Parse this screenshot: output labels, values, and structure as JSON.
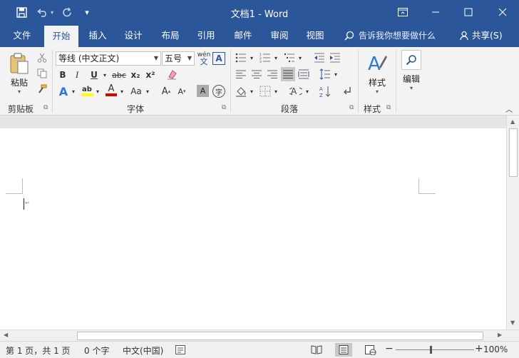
{
  "titlebar": {
    "title": "文档1  -  Word",
    "icons": [
      "save-icon",
      "undo-icon",
      "redo-icon",
      "customize-qat-icon",
      "ribbon-display-icon",
      "minimize-icon",
      "maximize-icon",
      "close-icon"
    ]
  },
  "tabs": [
    "文件",
    "开始",
    "插入",
    "设计",
    "布局",
    "引用",
    "邮件",
    "审阅",
    "视图"
  ],
  "active_tab": "开始",
  "tellme": "告诉我你想要做什么",
  "share": "共享(S)",
  "ribbon": {
    "clipboard": {
      "paste": "粘贴",
      "label": "剪贴板"
    },
    "font": {
      "font_name": "等线 (中文正文)",
      "font_size": "五号",
      "phonetic": "wén",
      "phonetic_char": "文",
      "bold": "B",
      "italic": "I",
      "underline": "U",
      "strike": "abc",
      "subscript": "x₂",
      "superscript": "x²",
      "text_effects": "A",
      "highlight": "ab",
      "font_color": "A",
      "change_case": "Aa",
      "grow": "A",
      "shrink": "A",
      "char_shading": "A",
      "enclose": "字",
      "label": "字体"
    },
    "paragraph": {
      "label": "段落"
    },
    "styles": {
      "button": "样式",
      "label": "样式"
    },
    "editing": {
      "button": "编辑"
    }
  },
  "statusbar": {
    "page": "第 1 页，共 1 页",
    "words": "0 个字",
    "language": "中文(中国)",
    "zoom": "100%",
    "zoom_minus": "−",
    "zoom_plus": "+"
  },
  "colors": {
    "brand": "#2b579a",
    "highlight_yellow": "#ffff00",
    "font_red": "#e00000"
  }
}
